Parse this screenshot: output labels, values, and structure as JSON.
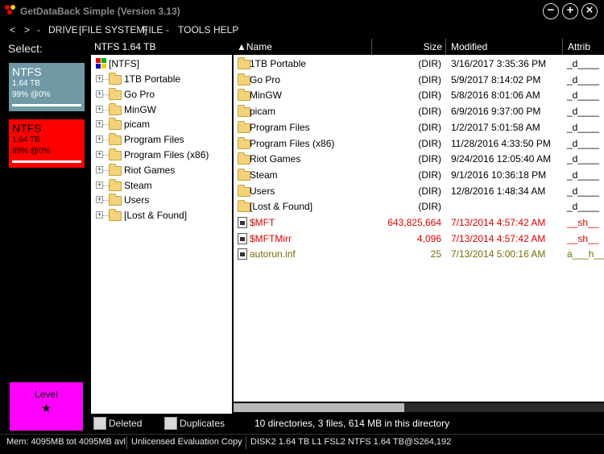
{
  "window": {
    "title": "GetDataBack Simple (Version 3.13)",
    "buttons": {
      "minimize": "−",
      "maximize": "+",
      "close": "×"
    }
  },
  "menu": {
    "back": "<",
    "forward": ">",
    "separator": "-",
    "drive": "DRIVE",
    "file_system": "[FILE SYSTEM]",
    "file": "FILE",
    "tools": "TOOLS",
    "help": "HELP"
  },
  "select_label": "Select:",
  "drives": [
    {
      "name": "NTFS",
      "size": "1.64 TB",
      "progress": "99% @0%",
      "color": "#6f9aa5",
      "text_color": "#ffffff"
    },
    {
      "name": "NTFS",
      "size": "1.64 TB",
      "progress": "99% @0%",
      "color": "#ff0000",
      "text_color": "#000000"
    }
  ],
  "level": {
    "label": "Level",
    "star": "★",
    "color": "#ff00ff"
  },
  "tree": {
    "header": "NTFS 1.64 TB",
    "root": "[NTFS]",
    "items": [
      {
        "label": "1TB Portable"
      },
      {
        "label": "Go Pro"
      },
      {
        "label": "MinGW"
      },
      {
        "label": "picam"
      },
      {
        "label": "Program Files"
      },
      {
        "label": "Program Files (x86)"
      },
      {
        "label": "Riot Games"
      },
      {
        "label": "Steam"
      },
      {
        "label": "Users"
      },
      {
        "label": "[Lost & Found]"
      }
    ]
  },
  "file_list": {
    "columns": {
      "name": "Name",
      "size": "Size",
      "modified": "Modified",
      "attrib": "Attrib",
      "sort_arrow": "▲"
    },
    "rows": [
      {
        "name": "1TB Portable",
        "size": "(DIR)",
        "modified": "3/16/2017 3:35:36 PM",
        "attrib": "_d____",
        "type": "dir",
        "style": "normal"
      },
      {
        "name": "Go Pro",
        "size": "(DIR)",
        "modified": "5/9/2017 8:14:02 PM",
        "attrib": "_d____",
        "type": "dir",
        "style": "normal"
      },
      {
        "name": "MinGW",
        "size": "(DIR)",
        "modified": "5/8/2016 8:01:06 AM",
        "attrib": "_d____",
        "type": "dir",
        "style": "normal"
      },
      {
        "name": "picam",
        "size": "(DIR)",
        "modified": "6/9/2016 9:37:00 PM",
        "attrib": "_d____",
        "type": "dir",
        "style": "normal"
      },
      {
        "name": "Program Files",
        "size": "(DIR)",
        "modified": "1/2/2017 5:01:58 AM",
        "attrib": "_d____",
        "type": "dir",
        "style": "normal"
      },
      {
        "name": "Program Files (x86)",
        "size": "(DIR)",
        "modified": "11/28/2016 4:33:50 PM",
        "attrib": "_d____",
        "type": "dir",
        "style": "normal"
      },
      {
        "name": "Riot Games",
        "size": "(DIR)",
        "modified": "9/24/2016 12:05:40 AM",
        "attrib": "_d____",
        "type": "dir",
        "style": "normal"
      },
      {
        "name": "Steam",
        "size": "(DIR)",
        "modified": "9/1/2016 10:36:18 PM",
        "attrib": "_d____",
        "type": "dir",
        "style": "normal"
      },
      {
        "name": "Users",
        "size": "(DIR)",
        "modified": "12/8/2016 1:48:34 AM",
        "attrib": "_d____",
        "type": "dir",
        "style": "normal"
      },
      {
        "name": "[Lost & Found]",
        "size": "(DIR)",
        "modified": "",
        "attrib": "_d____",
        "type": "dir",
        "style": "normal"
      },
      {
        "name": "$MFT",
        "size": "643,825,664",
        "modified": "7/13/2014 4:57:42 AM",
        "attrib": "__sh__",
        "type": "file",
        "style": "red"
      },
      {
        "name": "$MFTMirr",
        "size": "4,096",
        "modified": "7/13/2014 4:57:42 AM",
        "attrib": "__sh__",
        "type": "file",
        "style": "red"
      },
      {
        "name": "autorun.inf",
        "size": "25",
        "modified": "7/13/2014 5:00:16 AM",
        "attrib": "a___h__",
        "type": "file",
        "style": "olive"
      }
    ]
  },
  "filters": {
    "deleted": "Deleted",
    "duplicates": "Duplicates"
  },
  "summary": "10 directories, 3 files, 614 MB in this directory",
  "status": {
    "memory": "Mem: 4095MB tot 4095MB avl",
    "license": "Unlicensed Evaluation Copy",
    "disk": "DISK2 1.64 TB L1 FSL2 NTFS 1.64 TB@S264,192"
  },
  "scroll_position": 0.0
}
